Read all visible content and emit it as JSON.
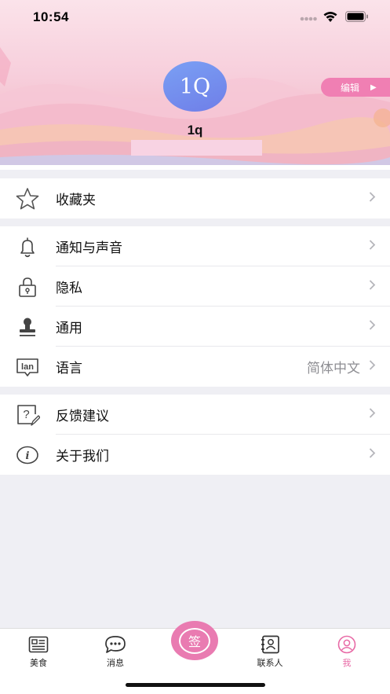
{
  "status_bar": {
    "time": "10:54"
  },
  "profile": {
    "avatar_text": "1Q",
    "username": "1q",
    "edit_label": "编辑"
  },
  "sections": [
    [
      {
        "name": "favorites",
        "icon": "star-icon",
        "label": "收藏夹",
        "value": ""
      }
    ],
    [
      {
        "name": "notifications",
        "icon": "bell-icon",
        "label": "通知与声音",
        "value": ""
      },
      {
        "name": "privacy",
        "icon": "lock-icon",
        "label": "隐私",
        "value": ""
      },
      {
        "name": "general",
        "icon": "stamp-icon",
        "label": "通用",
        "value": ""
      },
      {
        "name": "language",
        "icon": "language-icon",
        "label": "语言",
        "value": "简体中文"
      }
    ],
    [
      {
        "name": "feedback",
        "icon": "feedback-icon",
        "label": "反馈建议",
        "value": ""
      },
      {
        "name": "about",
        "icon": "info-icon",
        "label": "关于我们",
        "value": ""
      }
    ]
  ],
  "icon_labels": {
    "language_icon_text": "lan",
    "info_icon_text": "i",
    "feedback_icon_text": "?"
  },
  "tabbar": {
    "food": "美食",
    "messages": "消息",
    "sign": "签",
    "contacts": "联系人",
    "me": "我"
  },
  "colors": {
    "accent": "#e97bb1",
    "avatar": "#6f7ee8",
    "active_tab": "#e86aa6"
  }
}
